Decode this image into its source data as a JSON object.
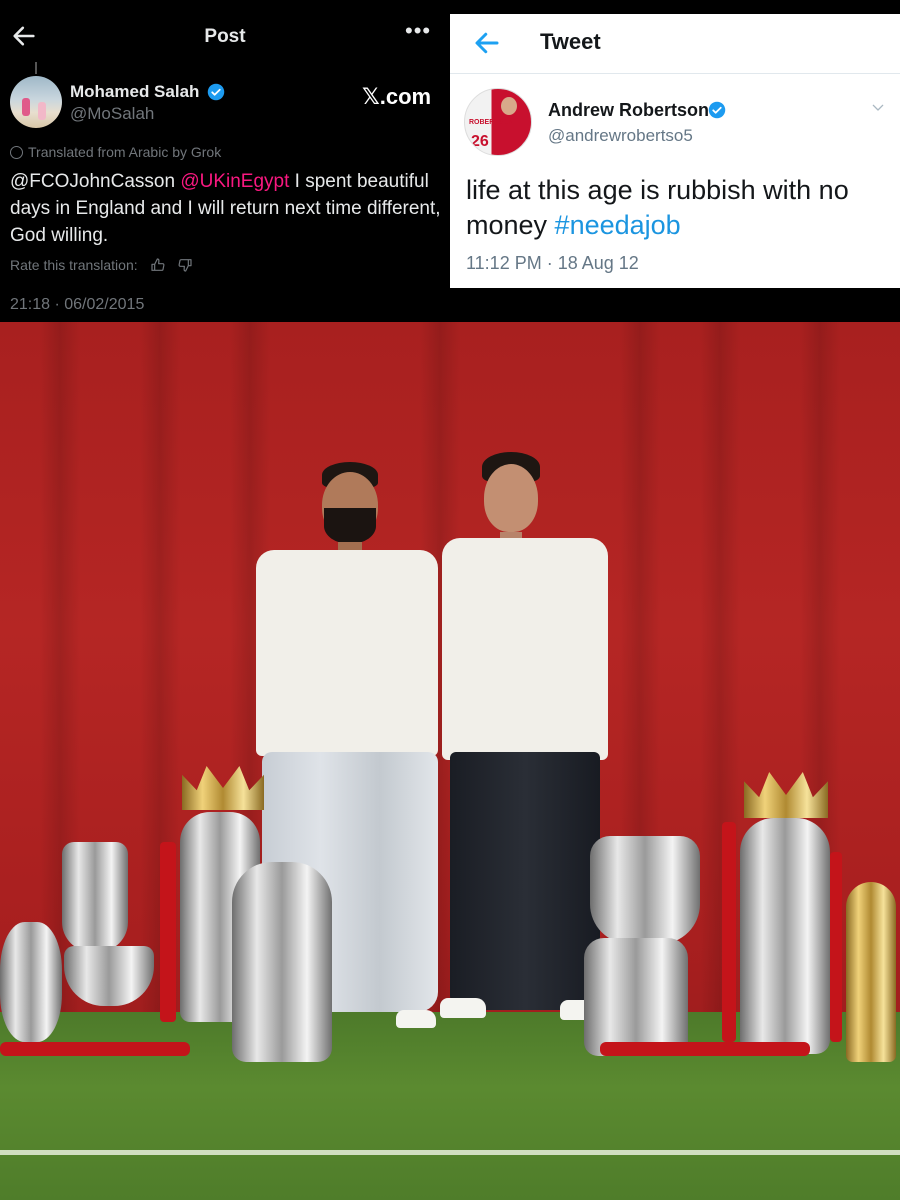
{
  "left_post": {
    "header_title": "Post",
    "more_label": "•••",
    "author_name": "Mohamed Salah",
    "author_handle": "@MoSalah",
    "source_label": "𝕏.com",
    "translated_note": "Translated from Arabic by Grok",
    "body": {
      "mention_1": "@FCOJohnCasson",
      "mention_2": "@UKinEgypt",
      "text": " I spent beautiful days in England and I will return next time different, God willing."
    },
    "rate_label": "Rate this translation:",
    "timestamp": "21:18 · 06/02/2015",
    "icons": [
      "back-arrow-icon",
      "more-icon",
      "verified-badge-icon",
      "grok-icon",
      "thumbs-up-icon",
      "thumbs-down-icon"
    ]
  },
  "right_tweet": {
    "header_title": "Tweet",
    "author_name": "Andrew Robertson",
    "author_handle": "@andrewrobertso5",
    "avatar_label": "ROBERTSON",
    "avatar_number": "26",
    "body": {
      "text": "life at this age is rubbish with no money ",
      "hashtag": "#needajob"
    },
    "time": "11:12 PM · 18 Aug 12",
    "icons": [
      "back-arrow-icon",
      "verified-badge-icon",
      "chevron-down-icon"
    ]
  },
  "colors": {
    "x_background": "#000000",
    "x_mention_pink": "#f91880",
    "twitter_blue": "#1da1f2",
    "hashtag_blue": "#1b95e0",
    "verified_blue": "#1d9bf0",
    "backdrop_red": "#b52624"
  }
}
